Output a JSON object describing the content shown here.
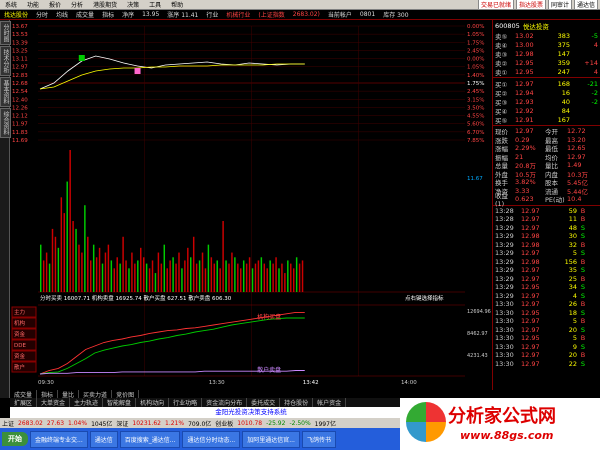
{
  "menubar": {
    "items": [
      "系统",
      "功能",
      "报价",
      "分析",
      "港股期货",
      "决策",
      "工具",
      "帮助"
    ],
    "right": [
      "交易已就绪",
      "指达股票"
    ],
    "winbtns": [
      "同审计",
      "通达信"
    ]
  },
  "toolbar": {
    "items": [
      "找达股份",
      "分时",
      "均线",
      "成交量",
      "指标",
      "净序",
      "13.95",
      "涨序 11.41",
      "行业",
      "机械行业",
      "(上证指数",
      "2683.02)",
      "当前帐户",
      "0801",
      "库存 300"
    ]
  },
  "lefttabs": [
    "分时图",
    "技术分析",
    "基本资料",
    "综合资料"
  ],
  "header": {
    "code": "600805",
    "name": "悦达投资"
  },
  "orderbook": {
    "sells": [
      {
        "l": "卖⑤",
        "p": "13.02",
        "v": "383",
        "d": "-5"
      },
      {
        "l": "卖④",
        "p": "13.00",
        "v": "375",
        "d": "4"
      },
      {
        "l": "卖③",
        "p": "12.98",
        "v": "147",
        "d": ""
      },
      {
        "l": "卖②",
        "p": "12.95",
        "v": "359",
        "d": "+14"
      },
      {
        "l": "卖①",
        "p": "12.95",
        "v": "247",
        "d": "4"
      }
    ],
    "buys": [
      {
        "l": "买①",
        "p": "12.97",
        "v": "168",
        "d": "-21"
      },
      {
        "l": "买②",
        "p": "12.94",
        "v": "16",
        "d": "-2"
      },
      {
        "l": "买③",
        "p": "12.93",
        "v": "40",
        "d": "-2"
      },
      {
        "l": "买④",
        "p": "12.92",
        "v": "84",
        "d": ""
      },
      {
        "l": "买⑤",
        "p": "12.91",
        "v": "167",
        "d": ""
      }
    ]
  },
  "stats": [
    {
      "k": "现价",
      "v": "12.97",
      "k2": "今开",
      "v2": "12.72"
    },
    {
      "k": "涨跌",
      "v": "0.29",
      "k2": "最高",
      "v2": "13.20"
    },
    {
      "k": "涨幅",
      "v": "2.29%",
      "k2": "最低",
      "v2": "12.65"
    },
    {
      "k": "振幅",
      "v": "21",
      "k2": "均价",
      "v2": "12.97"
    },
    {
      "k": "总量",
      "v": "20.8万",
      "k2": "量比",
      "v2": "1.49"
    },
    {
      "k": "外盘",
      "v": "10.5万",
      "k2": "内盘",
      "v2": "10.3万"
    },
    {
      "k": "换手",
      "v": "3.82%",
      "k2": "股本",
      "v2": "5.45亿"
    },
    {
      "k": "净资",
      "v": "3.33",
      "k2": "流通",
      "v2": "5.44亿"
    },
    {
      "k": "收益(1)",
      "v": "0.623",
      "k2": "PE(动)",
      "v2": "10.4"
    }
  ],
  "ticks": [
    {
      "t": "13:28",
      "p": "12.97",
      "v": "59",
      "bs": "B"
    },
    {
      "t": "13:28",
      "p": "12.97",
      "v": "11",
      "bs": "B"
    },
    {
      "t": "13:29",
      "p": "12.97",
      "v": "48",
      "bs": "S"
    },
    {
      "t": "13:29",
      "p": "12.98",
      "v": "30",
      "bs": "S"
    },
    {
      "t": "13:29",
      "p": "12.98",
      "v": "32",
      "bs": "B"
    },
    {
      "t": "13:29",
      "p": "12.97",
      "v": "5",
      "bs": "S"
    },
    {
      "t": "13:29",
      "p": "12.98",
      "v": "156",
      "bs": "B"
    },
    {
      "t": "13:29",
      "p": "12.97",
      "v": "35",
      "bs": "S"
    },
    {
      "t": "13:29",
      "p": "12.97",
      "v": "25",
      "bs": "B"
    },
    {
      "t": "13:29",
      "p": "12.95",
      "v": "34",
      "bs": "S"
    },
    {
      "t": "13:29",
      "p": "12.97",
      "v": "4",
      "bs": "S"
    },
    {
      "t": "13:30",
      "p": "12.97",
      "v": "26",
      "bs": "B"
    },
    {
      "t": "13:30",
      "p": "12.95",
      "v": "18",
      "bs": "S"
    },
    {
      "t": "13:30",
      "p": "12.97",
      "v": "5",
      "bs": "B"
    },
    {
      "t": "13:30",
      "p": "12.97",
      "v": "20",
      "bs": "S"
    },
    {
      "t": "13:30",
      "p": "12.95",
      "v": "5",
      "bs": "B"
    },
    {
      "t": "13:30",
      "p": "12.97",
      "v": "9",
      "bs": "S"
    },
    {
      "t": "13:30",
      "p": "12.97",
      "v": "20",
      "bs": "B"
    },
    {
      "t": "13:30",
      "p": "12.97",
      "v": "22",
      "bs": "S"
    }
  ],
  "chart_data": {
    "type": "line",
    "price_axis": [
      "13.67",
      "13.53",
      "13.39",
      "13.25",
      "13.11",
      "12.97",
      "12.83",
      "12.68",
      "12.54",
      "12.40",
      "12.26",
      "12.12",
      "11.97",
      "11.83",
      "11.69"
    ],
    "pct_axis": [
      "0.00%",
      "1.05%",
      "1.75%",
      "2.45%",
      "0.00%",
      "1.05%",
      "1.40%",
      "1.75%",
      "2.45%",
      "3.15%",
      "3.50%",
      "4.55%",
      "5.60%",
      "6.70%",
      "7.85%"
    ],
    "price_series": [
      12.72,
      12.78,
      12.9,
      13.0,
      13.05,
      13.02,
      12.98,
      12.95,
      12.93,
      12.96,
      12.97,
      12.98,
      12.99,
      12.97,
      12.96,
      12.98,
      12.97,
      12.96,
      12.97,
      12.97
    ],
    "avg_series": [
      12.72,
      12.74,
      12.8,
      12.86,
      12.9,
      12.92,
      12.93,
      12.93,
      12.94,
      12.94,
      12.95,
      12.95,
      12.95,
      12.96,
      12.96,
      12.96,
      12.96,
      12.97,
      12.97,
      12.97
    ],
    "volume_bars": [
      30,
      20,
      25,
      18,
      40,
      35,
      28,
      60,
      50,
      70,
      90,
      45,
      40,
      30,
      25,
      55,
      35,
      20,
      30,
      22,
      28,
      18,
      25,
      30,
      20,
      15,
      22,
      18,
      35,
      20,
      15,
      25,
      18,
      20,
      28,
      22,
      18,
      15,
      20,
      12,
      25,
      18,
      30,
      15,
      20,
      22,
      18,
      25,
      15,
      20,
      28,
      22,
      35,
      18,
      20,
      25,
      15,
      30,
      22,
      18,
      20,
      15,
      45,
      20,
      18,
      25,
      22,
      18,
      15,
      20,
      18,
      22,
      15,
      18,
      20,
      22,
      18,
      15,
      20,
      18,
      22,
      15,
      18,
      12,
      20,
      18,
      15,
      22,
      18,
      20
    ],
    "vol_label": "分时买卖 16007.71  机构卖盘 16925.74  散户买盘 627.51  散户卖盘 606.30",
    "vol_right": "点右键选择指标",
    "inst_buy": [
      0,
      5,
      8,
      15,
      25,
      35,
      40,
      45,
      48,
      50,
      53,
      55,
      58,
      60,
      62,
      63,
      65,
      66,
      68,
      70,
      72,
      74,
      76,
      78,
      80,
      82,
      84,
      86,
      88,
      88
    ],
    "inst_sell": [
      0,
      2,
      3,
      8,
      15,
      22,
      30,
      34,
      37,
      40,
      42,
      45,
      47,
      50,
      52,
      55,
      57,
      60,
      62,
      64,
      67,
      70,
      72,
      74,
      76,
      78,
      79,
      80,
      80,
      80
    ],
    "retail": [
      0,
      1,
      1,
      1,
      2,
      2,
      2,
      2,
      2,
      3,
      3,
      3,
      3,
      3,
      3,
      3,
      3,
      3,
      4,
      4,
      4,
      4,
      4,
      4,
      4,
      4,
      4,
      4,
      5,
      5
    ],
    "lower_axis": [
      "12694.96",
      "8462.97",
      "4231.43"
    ],
    "lower_label1": "机构买盘",
    "lower_label2": "散户卖盘",
    "time_labels": [
      "09:30",
      "13:30",
      "13:42",
      "14:00"
    ],
    "vol_axis": [
      "11.67"
    ]
  },
  "side_btns": [
    "主力",
    "机构",
    "资金",
    "DDE",
    "资金",
    "散户"
  ],
  "bottomtabs": [
    "成交量",
    "指标",
    "量比",
    "买卖力道",
    "竞价图"
  ],
  "bottomtabs2": [
    "扩展区",
    "大单资金",
    "主力轨迹",
    "智能解盘",
    "机构动向",
    "行业功略",
    "资金流向分布",
    "委托成交",
    "持仓股份",
    "帐户资金"
  ],
  "caption": "金阳光投资决策支持系统",
  "statusbar": [
    "上证",
    "2683.02",
    "27.63",
    "1.04%",
    "1045亿",
    "深证",
    "10231.62",
    "1.21%",
    "709.0亿",
    "创业板",
    "1010.78",
    "-25.92",
    "-2.50%",
    "1997亿"
  ],
  "taskbar": [
    "开始",
    "金融终端专业交...",
    "通达信",
    "百度搜索_通达信...",
    "通达信分时动态...",
    "加阿里通达信官...",
    "飞鸽传书"
  ],
  "logo": {
    "t1": "分析家公式网",
    "t2": "www.88gs.com"
  }
}
